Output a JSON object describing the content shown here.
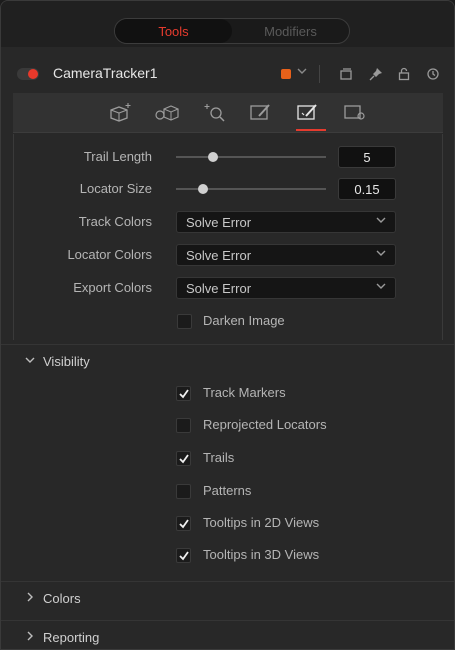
{
  "top_tabs": {
    "tools": "Tools",
    "modifiers": "Modifiers"
  },
  "tool": {
    "name": "CameraTracker1",
    "swatch_color": "#e8611a",
    "record_color": "#e8392b"
  },
  "header_icons": [
    "version-icon",
    "pin-icon",
    "lock-icon",
    "reset-icon"
  ],
  "icon_tabs": [
    {
      "name": "track-tab-icon"
    },
    {
      "name": "solve-tab-icon"
    },
    {
      "name": "export-tab-icon"
    },
    {
      "name": "options-tab-icon"
    },
    {
      "name": "display-options-tab-icon",
      "active": true
    },
    {
      "name": "settings-tab-icon"
    }
  ],
  "controls": {
    "trail_length": {
      "label": "Trail Length",
      "value": "5",
      "slider_fraction": 0.24
    },
    "locator_size": {
      "label": "Locator Size",
      "value": "0.15",
      "slider_fraction": 0.15
    },
    "track_colors": {
      "label": "Track Colors",
      "value": "Solve Error"
    },
    "locator_colors": {
      "label": "Locator Colors",
      "value": "Solve Error"
    },
    "export_colors": {
      "label": "Export Colors",
      "value": "Solve Error"
    },
    "darken_image": {
      "label": "Darken Image",
      "checked": false
    }
  },
  "visibility": {
    "title": "Visibility",
    "items": [
      {
        "label": "Track Markers",
        "checked": true
      },
      {
        "label": "Reprojected Locators",
        "checked": false
      },
      {
        "label": "Trails",
        "checked": true
      },
      {
        "label": "Patterns",
        "checked": false
      },
      {
        "label": "Tooltips in 2D Views",
        "checked": true
      },
      {
        "label": "Tooltips in 3D Views",
        "checked": true
      }
    ]
  },
  "sections": {
    "colors": "Colors",
    "reporting": "Reporting"
  },
  "accent": "#e63b2e"
}
